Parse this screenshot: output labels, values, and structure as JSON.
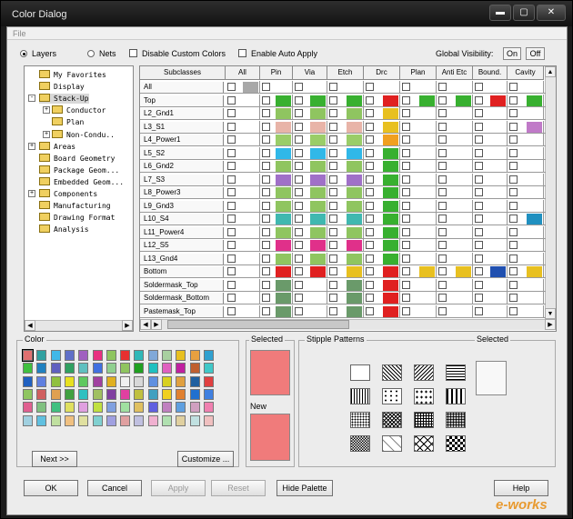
{
  "window": {
    "title": "Color Dialog",
    "min": "▬",
    "max": "▢",
    "close": "✕"
  },
  "menu": {
    "file": "File"
  },
  "options": {
    "layers": "Layers",
    "nets": "Nets",
    "disable_custom": "Disable Custom Colors",
    "auto_apply": "Enable Auto Apply",
    "global_visibility": "Global Visibility:",
    "on": "On",
    "off": "Off"
  },
  "tree": [
    {
      "label": "My Favorites",
      "indent": 0,
      "exp": ""
    },
    {
      "label": "Display",
      "indent": 0,
      "exp": ""
    },
    {
      "label": "Stack-Up",
      "indent": 0,
      "exp": "-",
      "selected": true
    },
    {
      "label": "Conductor",
      "indent": 1,
      "exp": "+"
    },
    {
      "label": "Plan",
      "indent": 1,
      "exp": ""
    },
    {
      "label": "Non-Condu..",
      "indent": 1,
      "exp": "+"
    },
    {
      "label": "Areas",
      "indent": 0,
      "exp": "+"
    },
    {
      "label": "Board Geometry",
      "indent": 0,
      "exp": ""
    },
    {
      "label": "Package Geom...",
      "indent": 0,
      "exp": ""
    },
    {
      "label": "Embedded Geom...",
      "indent": 0,
      "exp": ""
    },
    {
      "label": "Components",
      "indent": 0,
      "exp": "+"
    },
    {
      "label": "Manufacturing",
      "indent": 0,
      "exp": ""
    },
    {
      "label": "Drawing Format",
      "indent": 0,
      "exp": ""
    },
    {
      "label": "Analysis",
      "indent": 0,
      "exp": ""
    }
  ],
  "grid": {
    "headers": [
      "Subclasses",
      "All",
      "Pin",
      "Via",
      "Etch",
      "Drc",
      "Plan",
      "Anti Etc",
      "Bound.",
      "Cavity"
    ],
    "rows": [
      {
        "name": "All",
        "colors": [
          "#a8a8a8",
          "",
          "",
          "",
          "",
          "",
          "",
          "",
          ""
        ]
      },
      {
        "name": "Top",
        "colors": [
          "",
          "#38b030",
          "#38b030",
          "#38b030",
          "#e02020",
          "#38b030",
          "#38b030",
          "#e02020",
          "#38b030"
        ]
      },
      {
        "name": "L2_Gnd1",
        "colors": [
          "",
          "#8fc560",
          "#8fc560",
          "#8fc560",
          "#e8c020",
          "",
          "",
          "",
          ""
        ]
      },
      {
        "name": "L3_S1",
        "colors": [
          "",
          "#e8b4a8",
          "#e8b4a8",
          "#e8b4a8",
          "#e8c020",
          "",
          "",
          "",
          "#c07ac8"
        ]
      },
      {
        "name": "L4_Power1",
        "colors": [
          "",
          "#9acd68",
          "#9acd68",
          "#9acd68",
          "#f0a020",
          "",
          "",
          "",
          ""
        ]
      },
      {
        "name": "L5_S2",
        "colors": [
          "",
          "#30b8e8",
          "#30b8e8",
          "#30b8e8",
          "#38b030",
          "",
          "",
          "",
          ""
        ]
      },
      {
        "name": "L6_Gnd2",
        "colors": [
          "",
          "#8fc560",
          "#8fc560",
          "#8fc560",
          "#38b030",
          "",
          "",
          "",
          ""
        ]
      },
      {
        "name": "L7_S3",
        "colors": [
          "",
          "#a070c8",
          "#a070c8",
          "#a070c8",
          "#38b030",
          "",
          "",
          "",
          ""
        ]
      },
      {
        "name": "L8_Power3",
        "colors": [
          "",
          "#8fc560",
          "#8fc560",
          "#8fc560",
          "#38b030",
          "",
          "",
          "",
          ""
        ]
      },
      {
        "name": "L9_Gnd3",
        "colors": [
          "",
          "#8fc560",
          "#8fc560",
          "#8fc560",
          "#38b030",
          "",
          "",
          "",
          ""
        ]
      },
      {
        "name": "L10_S4",
        "colors": [
          "",
          "#40b8b0",
          "#40b8b0",
          "#40b8b0",
          "#38b030",
          "",
          "",
          "",
          "#2090c0"
        ]
      },
      {
        "name": "L11_Power4",
        "colors": [
          "",
          "#8fc560",
          "#8fc560",
          "#8fc560",
          "#38b030",
          "",
          "",
          "",
          ""
        ]
      },
      {
        "name": "L12_S5",
        "colors": [
          "",
          "#e0308a",
          "#e0308a",
          "#e0308a",
          "#38b030",
          "",
          "",
          "",
          ""
        ]
      },
      {
        "name": "L13_Gnd4",
        "colors": [
          "",
          "#8fc560",
          "#8fc560",
          "#8fc560",
          "#38b030",
          "",
          "",
          "",
          ""
        ]
      },
      {
        "name": "Bottom",
        "colors": [
          "",
          "#e02020",
          "#e02020",
          "#e8c020",
          "#e02020",
          "#e8c020",
          "#e8c020",
          "#2050b0",
          "#e8c020"
        ]
      },
      {
        "name": "Soldermask_Top",
        "colors": [
          "",
          "#6a9a6a",
          "",
          "#6a9a6a",
          "#e02020",
          "",
          "",
          "",
          ""
        ]
      },
      {
        "name": "Soldermask_Bottom",
        "colors": [
          "",
          "#6a9a6a",
          "",
          "#6a9a6a",
          "#e02020",
          "",
          "",
          "",
          ""
        ]
      },
      {
        "name": "Pastemask_Top",
        "colors": [
          "",
          "#6a9a6a",
          "",
          "#6a9a6a",
          "#e02020",
          "",
          "",
          "",
          ""
        ]
      }
    ]
  },
  "color_panel": {
    "label": "Color",
    "colors": [
      "#e07070",
      "#30a0a0",
      "#40b8e8",
      "#6070c8",
      "#a060c0",
      "#e83080",
      "#8fc560",
      "#e83030",
      "#30b8b8",
      "#80a8d8",
      "#a8d0a0",
      "#e8c020",
      "#e8a040",
      "#30a0d0",
      "#40c040",
      "#2080c0",
      "#6060c0",
      "#30a060",
      "#60c0c0",
      "#4070e0",
      "#90d090",
      "#8fc560",
      "#20a020",
      "#20c0c0",
      "#e060c0",
      "#c020a0",
      "#c06030",
      "#40c8c8",
      "#2060c0",
      "#6080e0",
      "#90c040",
      "#e8e020",
      "#60c860",
      "#a040a0",
      "#e0b020",
      "#f0f0f0",
      "#d8d8d8",
      "#6090e0",
      "#d8d020",
      "#e0a040",
      "#2060a0",
      "#e04040",
      "#8fc560",
      "#d06060",
      "#e0a050",
      "#40a040",
      "#30c0c0",
      "#a0c060",
      "#8040a0",
      "#e040a0",
      "#c0c040",
      "#40a0c0",
      "#f0d020",
      "#e08030",
      "#2070d0",
      "#4080e0",
      "#e06090",
      "#80c080",
      "#40c080",
      "#e0e060",
      "#e0a0e0",
      "#c0e040",
      "#80a0e0",
      "#a0e0a0",
      "#e0c060",
      "#6060e0",
      "#c080c0",
      "#60a0e0",
      "#d0a0c0",
      "#f080b0",
      "#a0d0e0",
      "#60c0e0",
      "#c0e0a0",
      "#f0c080",
      "#e0e0a0",
      "#80d0d0",
      "#a0a0e0",
      "#e0a0a0",
      "#c0c0e0",
      "#f0b0d0",
      "#b0e0b0",
      "#e0d0a0",
      "#c0e0e0",
      "#f0c0c0"
    ],
    "next": "Next >>",
    "customize": "Customize ..."
  },
  "selected_label": "Selected",
  "new_label": "New",
  "selected_color": "#f07b7b",
  "new_color": "#f07b7b",
  "stipple": {
    "label": "Stipple Patterns",
    "selected_label": "Selected",
    "patterns": [
      "blank",
      "diag-down",
      "diag-up",
      "horizontal",
      "vertical",
      "dots-sparse",
      "dots-plus",
      "dots-dash",
      "dots-fine",
      "cross-diag",
      "grid",
      "dots-dense",
      "checker",
      "diamond",
      "xpattern",
      "checker-dense"
    ]
  },
  "buttons": {
    "ok": "OK",
    "cancel": "Cancel",
    "apply": "Apply",
    "reset": "Reset",
    "hide_palette": "Hide Palette",
    "help": "Help"
  },
  "watermark": "e-works"
}
